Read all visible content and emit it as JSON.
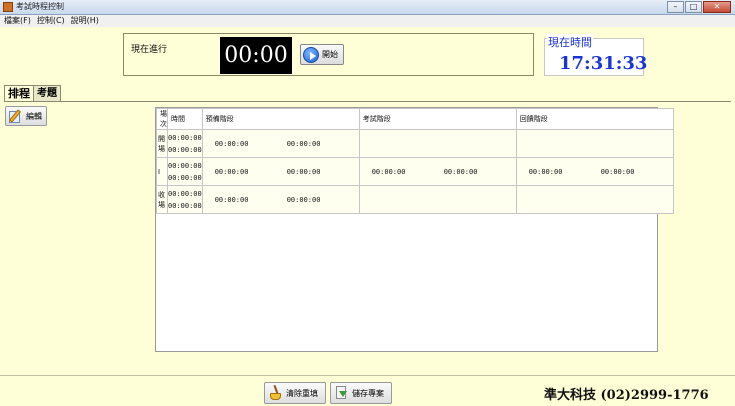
{
  "window": {
    "title": "考試時程控制"
  },
  "menu": [
    {
      "label": "檔案(F)"
    },
    {
      "label": "控制(C)"
    },
    {
      "label": "說明(H)"
    }
  ],
  "top": {
    "running_label": "現在進行",
    "timer": "00:00",
    "start_label": "開始"
  },
  "clock": {
    "title": "現在時間",
    "time": "17:31:33"
  },
  "tabs": [
    {
      "label": "排程"
    },
    {
      "label": "考題"
    }
  ],
  "edit_label": "編輯",
  "table": {
    "headers": [
      "場次",
      "時間",
      "預備階段",
      "考試階段",
      "回饋階段"
    ],
    "rows": [
      {
        "scene": "開場",
        "time_start": "00:00:00",
        "time_end": "00:00:00",
        "prep_a": "00:00:00",
        "prep_b": "00:00:00",
        "exam_a": "",
        "exam_b": "",
        "feedback_a": "",
        "feedback_b": ""
      },
      {
        "scene": "I",
        "time_start": "00:00:00",
        "time_end": "00:00:00",
        "prep_a": "00:00:00",
        "prep_b": "00:00:00",
        "exam_a": "00:00:00",
        "exam_b": "00:00:00",
        "feedback_a": "00:00:00",
        "feedback_b": "00:00:00"
      },
      {
        "scene": "收場",
        "time_start": "00:00:00",
        "time_end": "00:00:00",
        "prep_a": "00:00:00",
        "prep_b": "00:00:00",
        "exam_a": "",
        "exam_b": "",
        "feedback_a": "",
        "feedback_b": ""
      }
    ]
  },
  "bottom": {
    "clear_label": "清除重填",
    "save_label": "儲存專案",
    "company": "準大科技  (02)2999-1776"
  },
  "colors": {
    "background": "#ffffd7",
    "clock_text": "#1a34d6",
    "timer_bg": "#000000"
  },
  "icons": [
    "play-icon",
    "edit-icon",
    "broom-icon",
    "save-icon"
  ]
}
